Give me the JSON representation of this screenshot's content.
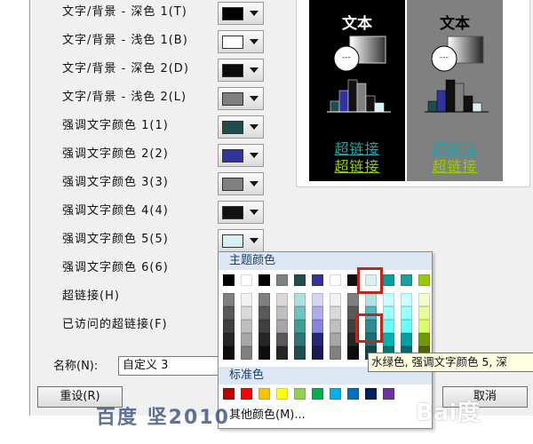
{
  "theme_rows": [
    {
      "label": "文字/背景 - 深色 1(T)",
      "color": "#000000"
    },
    {
      "label": "文字/背景 - 浅色 1(B)",
      "color": "#ffffff"
    },
    {
      "label": "文字/背景 - 深色 2(D)",
      "color": "#0b0b0b"
    },
    {
      "label": "文字/背景 - 浅色 2(L)",
      "color": "#7f7f7f"
    },
    {
      "label": "强调文字颜色 1(1)",
      "color": "#1f4e4e"
    },
    {
      "label": "强调文字颜色 2(2)",
      "color": "#3333a0"
    },
    {
      "label": "强调文字颜色 3(3)",
      "color": "#808080"
    },
    {
      "label": "强调文字颜色 4(4)",
      "color": "#111111"
    },
    {
      "label": "强调文字颜色 5(5)",
      "color": "#d9f0f3"
    },
    {
      "label": "强调文字颜色 6(6)",
      "color": null
    },
    {
      "label": "超链接(H)",
      "color": null
    },
    {
      "label": "已访问的超链接(F)",
      "color": null
    }
  ],
  "preview": {
    "dark": {
      "title": "文本",
      "link": "超链接",
      "visited": "超链接",
      "bg": "#000000"
    },
    "light": {
      "title": "文本",
      "link": "超链接",
      "visited": "超链接",
      "bg": "#808080"
    }
  },
  "name_label": "名称(N):",
  "name_value": "自定义 3",
  "reset_label": "重设(R)",
  "cancel_label": "取消",
  "popup": {
    "theme_header": "主题颜色",
    "standard_header": "标准色",
    "more_colors": "其他颜色(M)...",
    "theme_top": [
      "#000000",
      "#ffffff",
      "#000000",
      "#808080",
      "#1f4e4e",
      "#3333a0",
      "#ffffff",
      "#111111",
      "#d9f0f3",
      "#00a0a0",
      "#1aa0a0",
      "#99cc00"
    ],
    "theme_shades": [
      [
        "#7f7f7f",
        "#595959",
        "#404040",
        "#262626",
        "#0d0d0d"
      ],
      [
        "#f2f2f2",
        "#d9d9d9",
        "#bfbfbf",
        "#a6a6a6",
        "#808080"
      ],
      [
        "#7f7f7f",
        "#595959",
        "#404040",
        "#262626",
        "#0d0d0d"
      ],
      [
        "#d9d9d9",
        "#bfbfbf",
        "#a6a6a6",
        "#595959",
        "#262626"
      ],
      [
        "#aedede",
        "#6fc3c3",
        "#3e9e9e",
        "#2e7676",
        "#1f4e4e"
      ],
      [
        "#d6d6f2",
        "#adadea",
        "#8585df",
        "#27277a",
        "#1a1a52"
      ],
      [
        "#f2f2f2",
        "#d9d9d9",
        "#bfbfbf",
        "#a6a6a6",
        "#808080"
      ],
      [
        "#7f7f7f",
        "#595959",
        "#404040",
        "#262626",
        "#0d0d0d"
      ],
      [
        "#b4e1e6",
        "#4fb8c2",
        "#2e8b94",
        "#1e6d74",
        "#12474c"
      ],
      [
        "#ccffff",
        "#99ffff",
        "#66ffff",
        "#00b3b3",
        "#007777"
      ],
      [
        "#ccffff",
        "#99ffff",
        "#66ffff",
        "#00a0a0",
        "#006b6b"
      ],
      [
        "#f2ffcc",
        "#e6ff99",
        "#d9ff66",
        "#739900",
        "#4c6600"
      ]
    ],
    "standard": [
      "#c00000",
      "#ff0000",
      "#ffc000",
      "#ffff00",
      "#92d050",
      "#00b050",
      "#00b0f0",
      "#0070c0",
      "#002060",
      "#7030a0"
    ]
  },
  "tooltip": "水绿色, 强调文字颜色 5, 深",
  "watermark_left": "百度 坚2010",
  "watermark_right": "Bai度"
}
